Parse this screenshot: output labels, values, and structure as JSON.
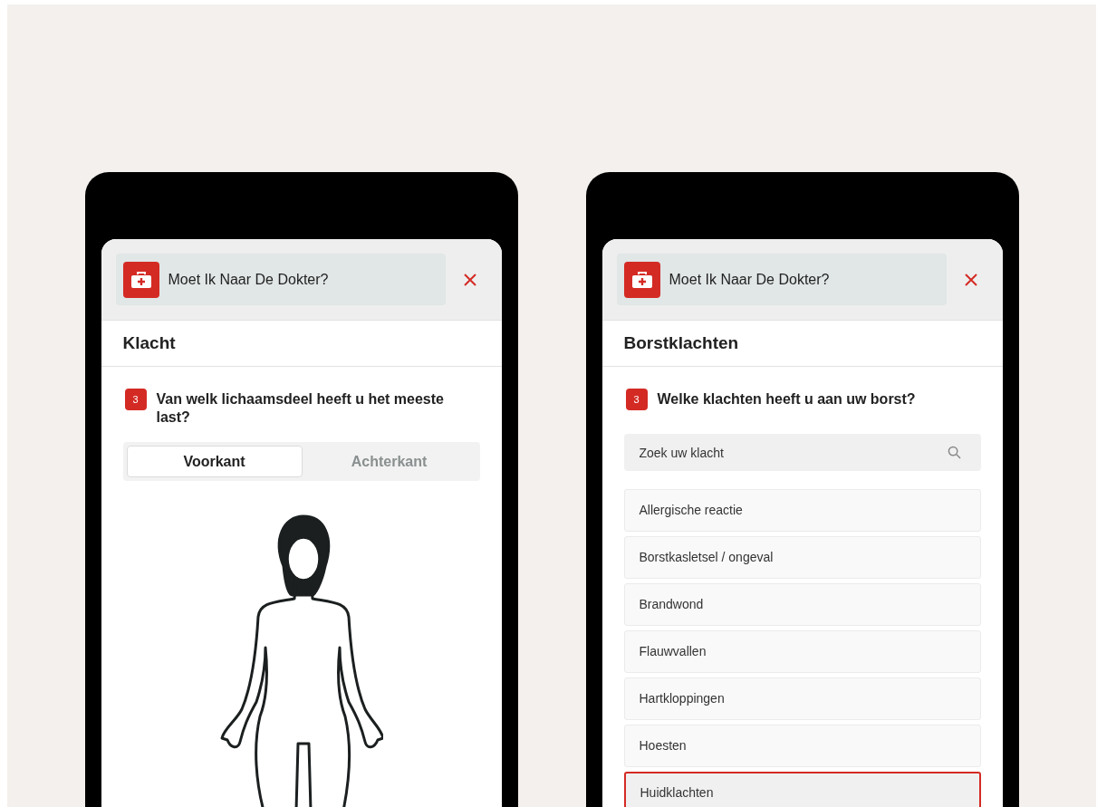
{
  "screens": [
    {
      "kind": "body_map",
      "app_title": "Moet Ik Naar De Dokter?",
      "section_title": "Klacht",
      "question": {
        "number": "3",
        "text": "Van welk lichaamsdeel heeft u het meeste last?"
      },
      "tabs": [
        {
          "label": "Voorkant",
          "selected": true
        },
        {
          "label": "Achterkant",
          "selected": false
        }
      ]
    },
    {
      "kind": "list",
      "app_title": "Moet Ik Naar De Dokter?",
      "section_title": "Borstklachten",
      "question": {
        "number": "3",
        "text": "Welke klachten heeft u aan uw borst?"
      },
      "search": {
        "placeholder": "Zoek uw klacht"
      },
      "items": [
        {
          "label": "Allergische reactie",
          "selected": false
        },
        {
          "label": "Borstkasletsel / ongeval",
          "selected": false
        },
        {
          "label": "Brandwond",
          "selected": false
        },
        {
          "label": "Flauwvallen",
          "selected": false
        },
        {
          "label": "Hartkloppingen",
          "selected": false
        },
        {
          "label": "Hoesten",
          "selected": false
        },
        {
          "label": "Huidklachten",
          "selected": true
        }
      ]
    }
  ]
}
